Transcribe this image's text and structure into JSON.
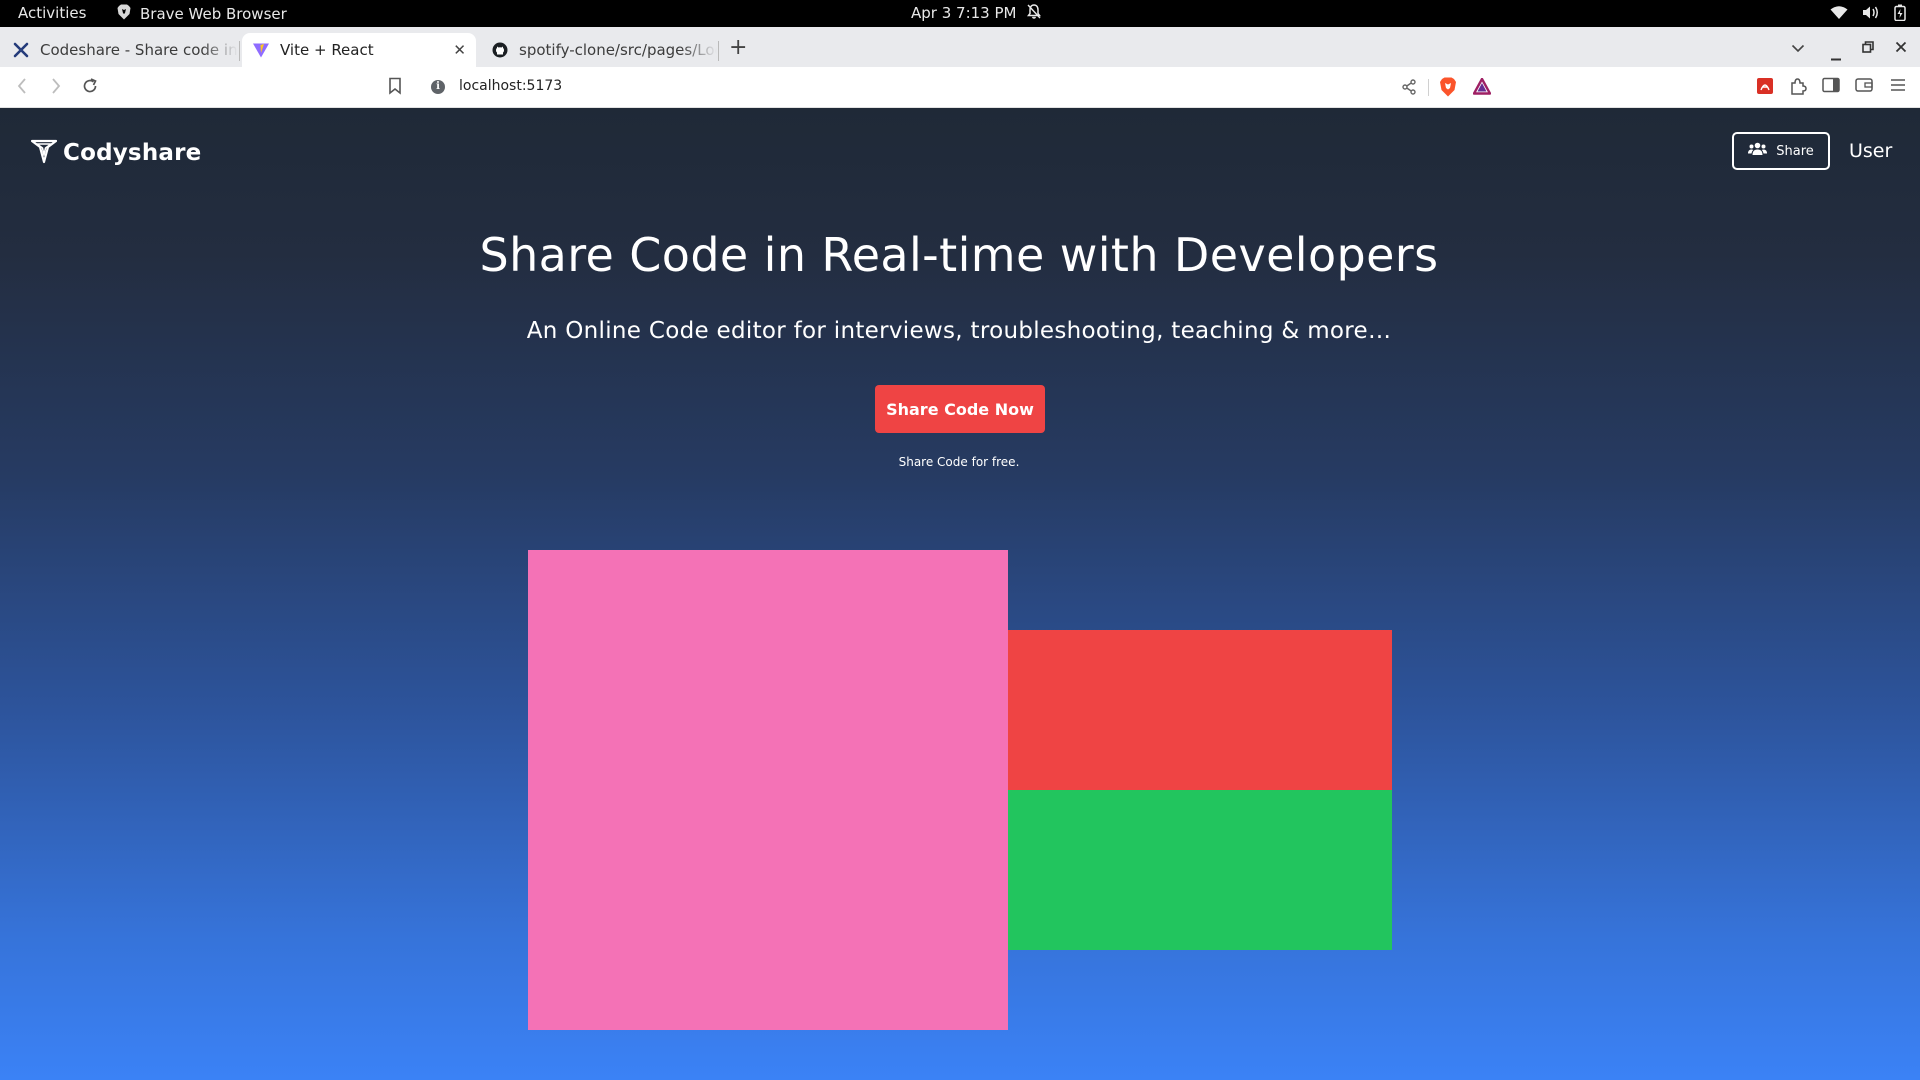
{
  "system_bar": {
    "activities": "Activities",
    "app_name": "Brave Web Browser",
    "clock": "Apr 3  7:13 PM"
  },
  "browser": {
    "tabs": [
      {
        "title": "Codeshare - Share code in re",
        "icon": "codeshare-favicon"
      },
      {
        "title": "Vite + React",
        "icon": "vite-favicon",
        "active": true
      },
      {
        "title": "spotify-clone/src/pages/Log",
        "icon": "github-favicon"
      }
    ],
    "url": "localhost:5173"
  },
  "page": {
    "brand": "Codyshare",
    "nav": {
      "share_label": "Share",
      "user_label": "User"
    },
    "hero": {
      "title": "Share Code in Real-time with Developers",
      "subtitle": "An Online Code editor for interviews, troubleshooting, teaching & more…",
      "cta_label": "Share Code Now",
      "note": "Share Code for free."
    },
    "colors": {
      "accent": "#ef4444",
      "pink_block": "#f472b6",
      "red_block": "#ef4444",
      "green_block": "#22c55e",
      "bg_top": "#1f2937",
      "bg_bottom": "#3b82f6"
    }
  }
}
